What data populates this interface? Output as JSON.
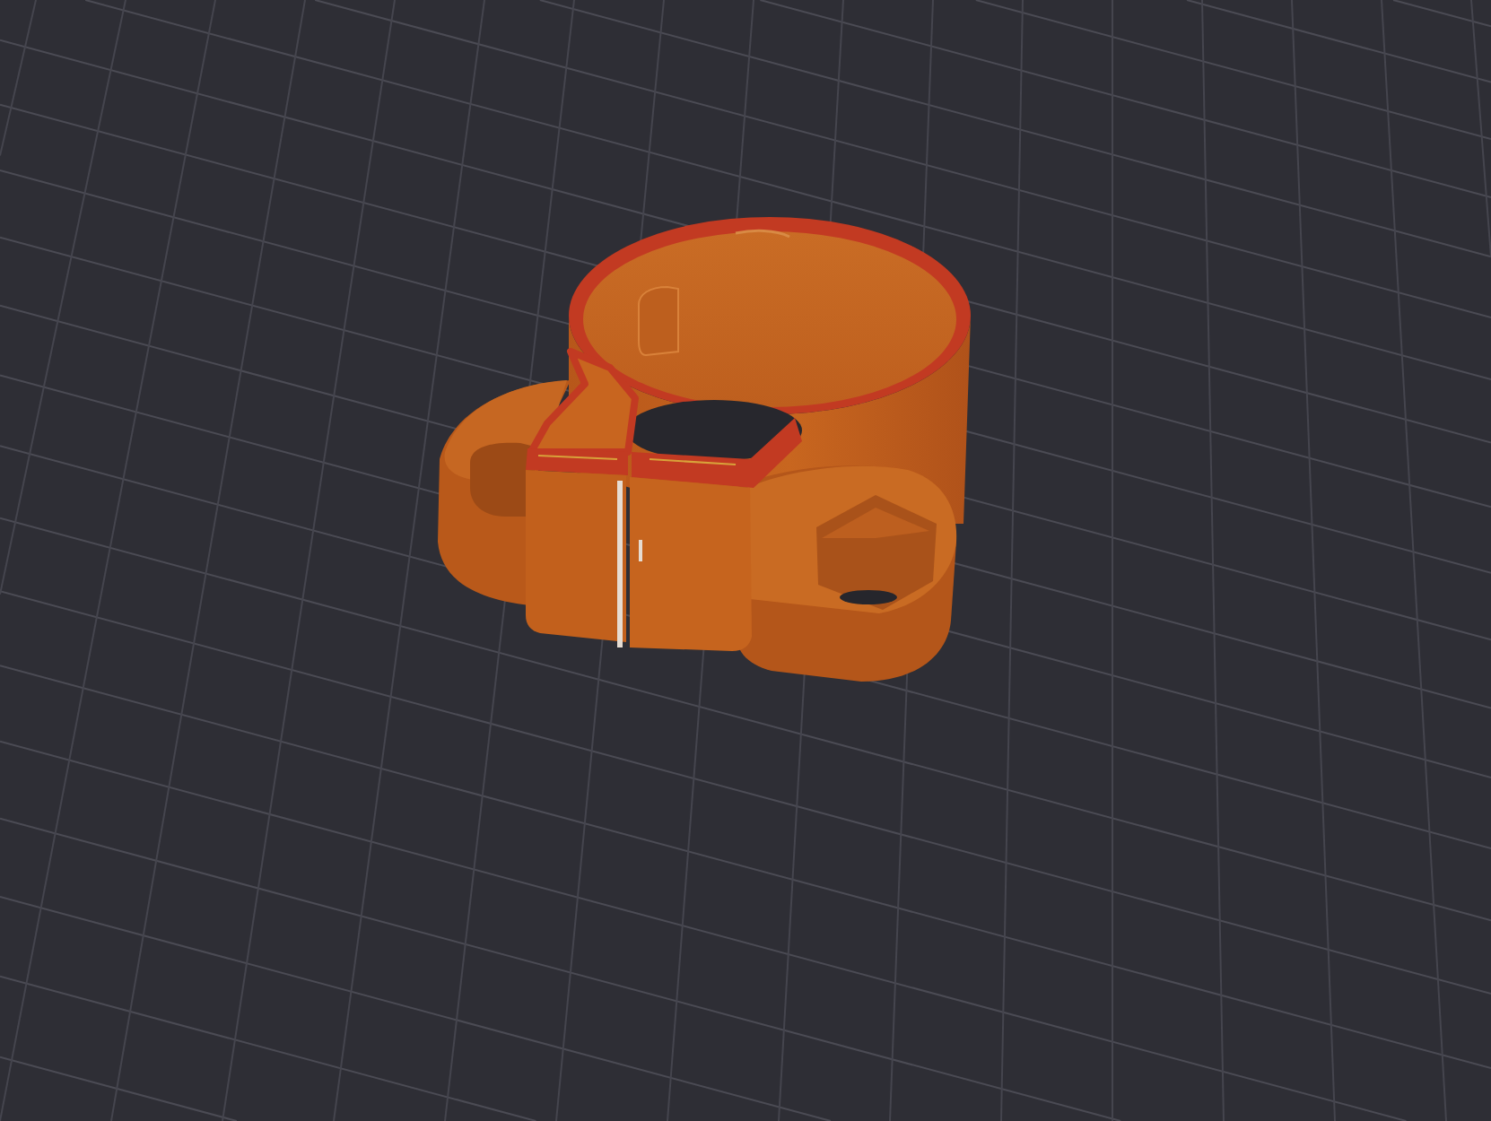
{
  "viewport": {
    "kind": "build-plate",
    "objects": [
      {
        "kind": "clamp"
      }
    ]
  }
}
